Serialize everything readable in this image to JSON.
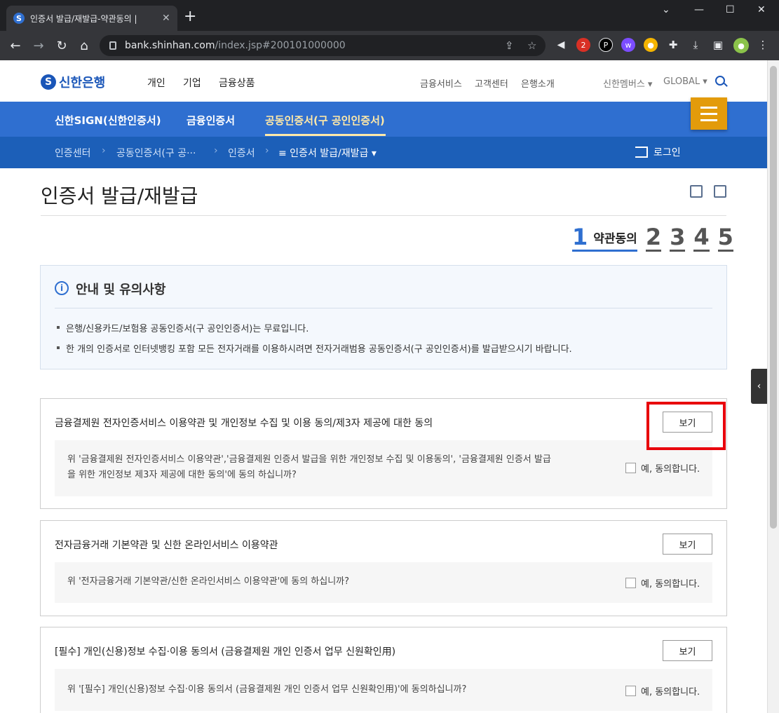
{
  "browser": {
    "tab_title": "인증서 발급/재발급-약관동의 |",
    "url_host": "bank.shinhan.com",
    "url_path": "/index.jsp#200101000000",
    "ext_badge": "2"
  },
  "header": {
    "logo": "신한은행",
    "main_menu": [
      "개인",
      "기업",
      "금융상품"
    ],
    "util_menu": [
      "금융서비스",
      "고객센터",
      "은행소개"
    ],
    "members": "신한멤버스 ▾",
    "global": "GLOBAL ▾"
  },
  "lnb": {
    "items": [
      "신한SIGN(신한인증서)",
      "금융인증서",
      "공동인증서(구 공인인증서)"
    ]
  },
  "breadcrumb": {
    "items": [
      "인증센터",
      "공동인증서(구 공···",
      "인증서"
    ],
    "current": "≡ 인증서 발급/재발급 ▾",
    "login": "로그인"
  },
  "page": {
    "title": "인증서 발급/재발급"
  },
  "steps": {
    "active_num": "1",
    "active_label": "약관동의",
    "others": [
      "2",
      "3",
      "4",
      "5"
    ]
  },
  "notice": {
    "title": "안내 및 유의사항",
    "items": [
      "은행/신용카드/보험용 공동인증서(구 공인인증서)는 무료입니다.",
      "한 개의 인증서로 인터넷뱅킹 포함 모든 전자거래를 이용하시려면 전자거래범용 공동인증서(구 공인인증서)를 발급받으시기 바랍니다."
    ]
  },
  "terms": [
    {
      "title": "금융결제원 전자인증서비스 이용약관 및 개인정보 수집 및 이용 동의/제3자 제공에 대한 동의",
      "button": "보기",
      "question_line1": "위 '금융결제원 전자인증서비스 이용약관','금융결제원 인증서 발급을 위한 개인정보 수집 및 이용동의', '금융결제원 인증서 발급",
      "question_line2": "을 위한 개인정보 제3자 제공에 대한 동의'에 동의 하십니까?",
      "agree": "예, 동의합니다."
    },
    {
      "title": "전자금융거래 기본약관 및 신한 온라인서비스 이용약관",
      "button": "보기",
      "question_line1": "위 '전자금융거래 기본약관/신한 온라인서비스 이용약관'에 동의 하십니까?",
      "agree": "예, 동의합니다."
    },
    {
      "title": "[필수] 개인(신용)정보 수집·이용 동의서 (금융결제원 개인 인증서 업무 신원확인用)",
      "button": "보기",
      "question_line1": "위 '[필수] 개인(신용)정보 수집·이용 동의서 (금융결제원 개인 인증서 업무 신원확인用)'에 동의하십니까?",
      "agree": "예, 동의합니다."
    }
  ],
  "colors": {
    "brand_blue": "#2f6fd0",
    "dark_blue": "#1c5fb8",
    "menu_orange": "#e39b0b",
    "highlight_red": "#e8000b"
  }
}
